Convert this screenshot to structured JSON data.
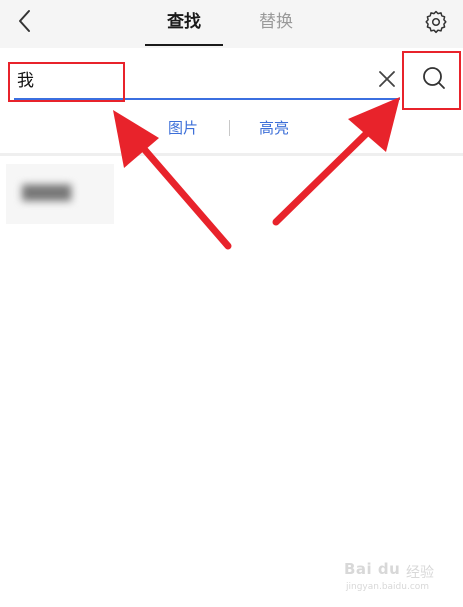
{
  "header": {
    "tabs": [
      {
        "label": "查找",
        "active": true
      },
      {
        "label": "替换",
        "active": false
      }
    ],
    "back_icon": "chevron-left-icon",
    "settings_icon": "gear-icon"
  },
  "search": {
    "value": "我",
    "clear_icon": "close-icon",
    "search_icon": "search-icon",
    "underline_color": "#3b6fe0"
  },
  "options": [
    {
      "label": "图片"
    },
    {
      "label": "高亮"
    }
  ],
  "annotation": {
    "color": "#e8232b"
  },
  "watermark": {
    "logo": "Bai du",
    "cn": "经验",
    "url": "jingyan.baidu.com"
  }
}
